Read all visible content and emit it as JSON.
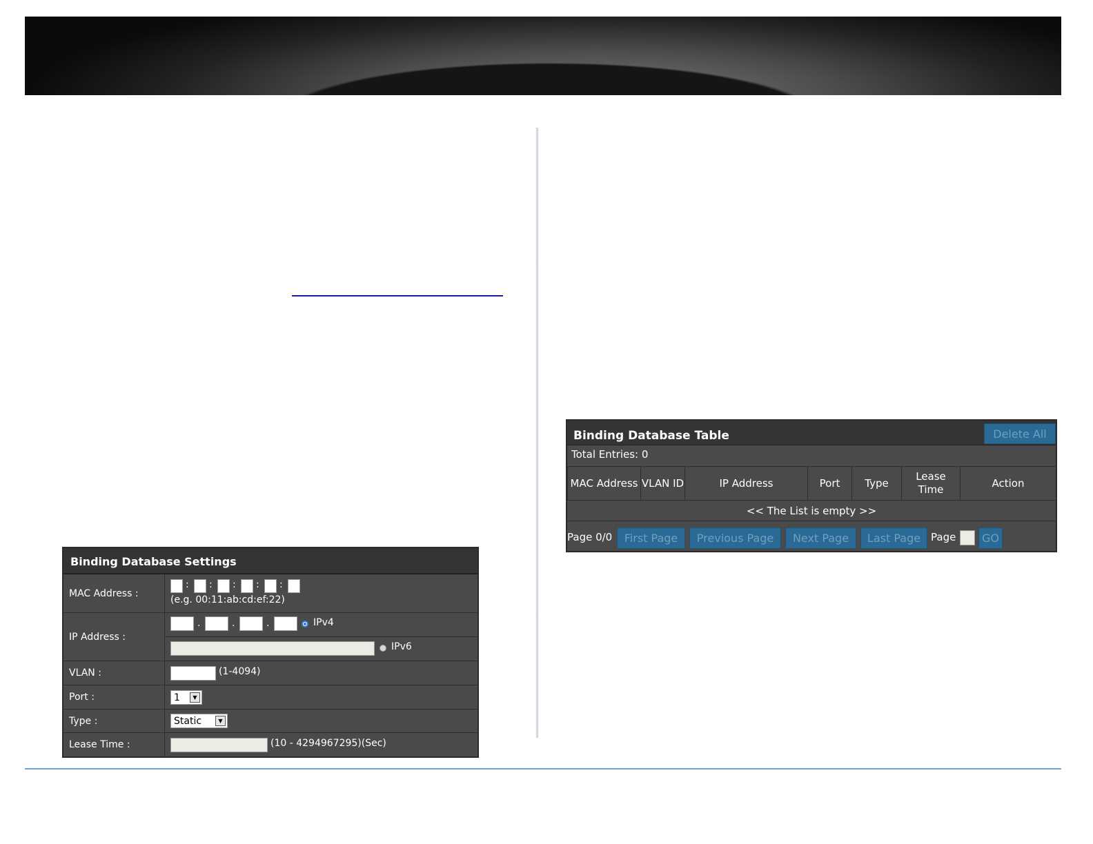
{
  "settings": {
    "title": "Binding Database Settings",
    "mac_label": "MAC Address :",
    "mac_separator": ":",
    "mac_hint": "(e.g. 00:11:ab:cd:ef:22)",
    "ip_label": "IP Address :",
    "ip_separator": ".",
    "ipv4_label": "IPv4",
    "ipv6_label": "IPv6",
    "ip_version_selected": "IPv4",
    "vlan_label": "VLAN :",
    "vlan_hint": "(1-4094)",
    "port_label": "Port :",
    "port_value": "1",
    "type_label": "Type :",
    "type_value": "Static",
    "lease_label": "Lease Time :",
    "lease_hint": "(10 - 4294967295)(Sec)"
  },
  "table": {
    "title": "Binding Database Table",
    "delete_all": "Delete All",
    "total_entries": "Total Entries: 0",
    "columns": [
      "MAC Address",
      "VLAN ID",
      "IP Address",
      "Port",
      "Type",
      "Lease Time",
      "Action"
    ],
    "empty_message": "<< The List is empty >>",
    "page_status": "Page 0/0",
    "first_page": "First Page",
    "previous_page": "Previous Page",
    "next_page": "Next Page",
    "last_page": "Last Page",
    "page_label": "Page",
    "go": "GO"
  },
  "colors": {
    "panel_bg": "#4a4a4a",
    "panel_title_bg": "#343434",
    "button_bg": "#2b6a95",
    "footer_rule": "#6fa4d6"
  }
}
